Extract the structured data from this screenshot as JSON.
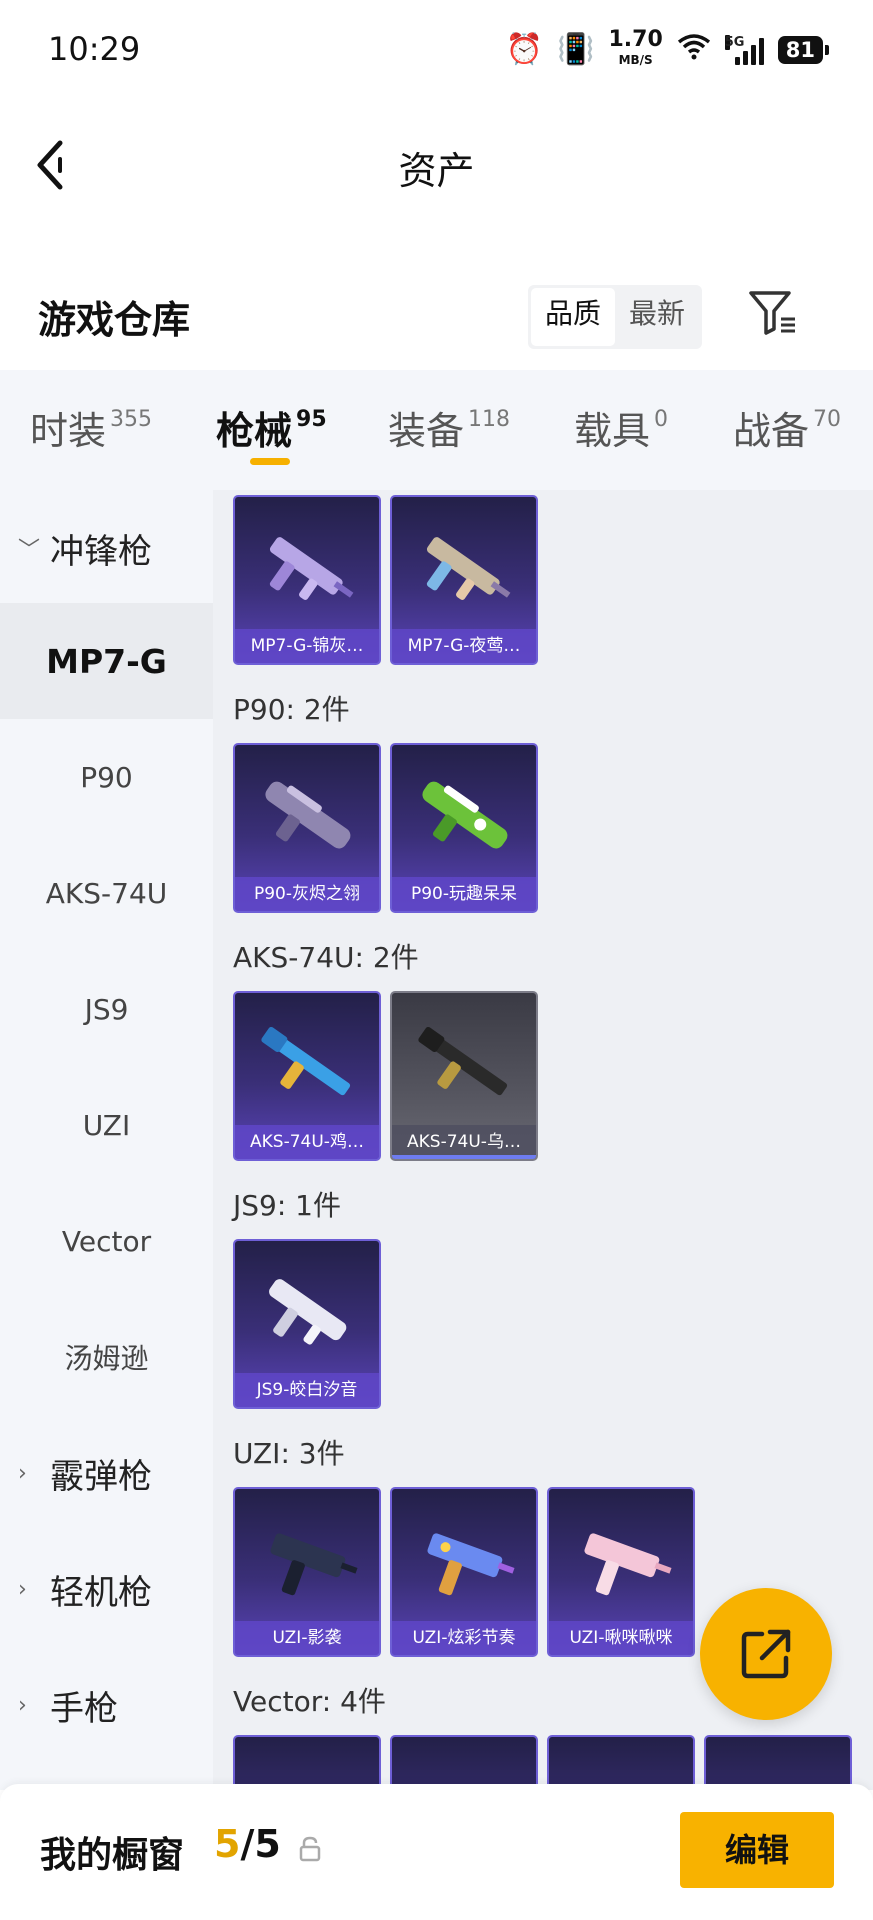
{
  "status_bar": {
    "time": "10:29",
    "net_speed": "1.70",
    "net_unit": "MB/S",
    "network": "5G",
    "battery": "81"
  },
  "header": {
    "title": "资产"
  },
  "warehouse": {
    "heading": "游戏仓库",
    "sort_options": [
      "品质",
      "最新"
    ],
    "sort_selected": "品质"
  },
  "tabs": [
    {
      "label": "时装",
      "count": "355"
    },
    {
      "label": "枪械",
      "count": "95"
    },
    {
      "label": "装备",
      "count": "118"
    },
    {
      "label": "载具",
      "count": "0"
    },
    {
      "label": "战备",
      "count": "70"
    }
  ],
  "active_tab": "枪械",
  "sidebar": {
    "categories": [
      {
        "label": "冲锋枪",
        "expanded": true
      },
      {
        "label": "霰弹枪",
        "expanded": false
      },
      {
        "label": "轻机枪",
        "expanded": false
      },
      {
        "label": "手枪",
        "expanded": false
      }
    ],
    "items": [
      "MP7-G",
      "P90",
      "AKS-74U",
      "JS9",
      "UZI",
      "Vector",
      "汤姆逊"
    ],
    "selected_item": "MP7-G"
  },
  "groups": [
    {
      "title": "",
      "items": [
        "MP7-G-锦灰…",
        "MP7-G-夜莺…"
      ]
    },
    {
      "title": "P90: 2件",
      "items": [
        "P90-灰烬之翎",
        "P90-玩趣呆呆"
      ]
    },
    {
      "title": "AKS-74U: 2件",
      "items": [
        "AKS-74U-鸡…",
        "AKS-74U-乌…"
      ]
    },
    {
      "title": "JS9: 1件",
      "items": [
        "JS9-皎白汐音"
      ]
    },
    {
      "title": "UZI: 3件",
      "items": [
        "UZI-影袭",
        "UZI-炫彩节奏",
        "UZI-啾咪啾咪"
      ]
    },
    {
      "title": "Vector: 4件",
      "items": [
        "",
        "",
        "",
        ""
      ]
    }
  ],
  "bottom_bar": {
    "label": "我的橱窗",
    "count_current": "5",
    "count_sep": "/",
    "count_total": "5",
    "edit_label": "编辑"
  },
  "colors": {
    "accent": "#f8b200",
    "card_purple": "#5a44b8",
    "card_gray": "#55555f"
  }
}
